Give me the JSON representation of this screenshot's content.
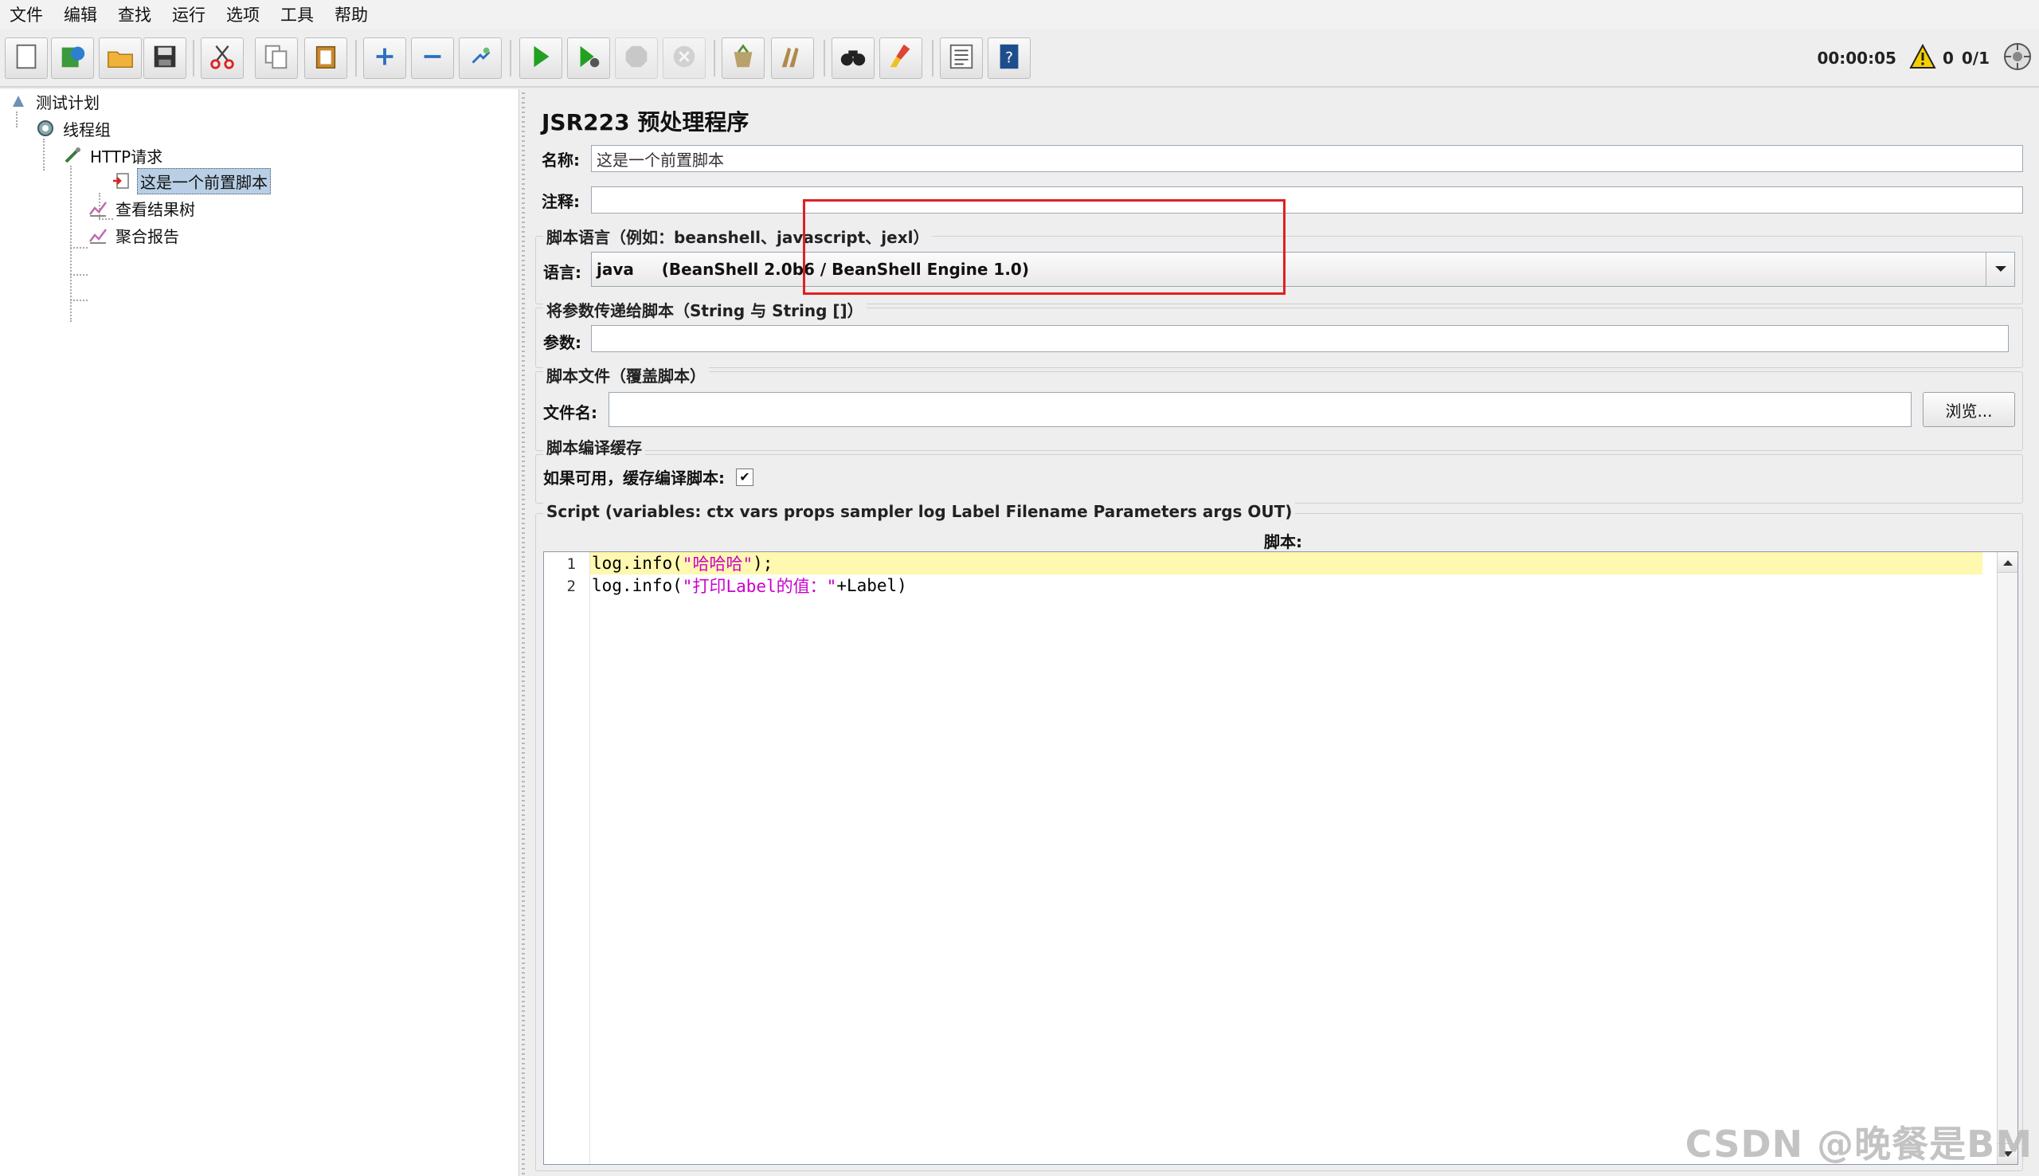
{
  "menu": [
    "文件",
    "编辑",
    "查找",
    "运行",
    "选项",
    "工具",
    "帮助"
  ],
  "toolbar": {
    "buttons": [
      {
        "name": "new-icon"
      },
      {
        "name": "templates-icon"
      },
      {
        "name": "open-icon"
      },
      {
        "name": "save-icon"
      },
      {
        "name": "cut-icon"
      },
      {
        "name": "copy-icon"
      },
      {
        "name": "paste-icon"
      },
      {
        "name": "expand-icon"
      },
      {
        "name": "collapse-icon"
      },
      {
        "name": "toggle-icon"
      },
      {
        "name": "start-icon"
      },
      {
        "name": "start-no-pause-icon"
      },
      {
        "name": "stop-icon"
      },
      {
        "name": "shutdown-icon"
      },
      {
        "name": "clear-icon"
      },
      {
        "name": "clear-all-icon"
      },
      {
        "name": "search-icon"
      },
      {
        "name": "reset-search-icon"
      },
      {
        "name": "function-helper-icon"
      },
      {
        "name": "help-icon"
      }
    ],
    "elapsed": "00:00:05",
    "warnings": "0",
    "threads": "0/1"
  },
  "tree": {
    "items": [
      {
        "label": "测试计划",
        "icon": "test-plan-icon"
      },
      {
        "label": "线程组",
        "icon": "thread-group-icon"
      },
      {
        "label": "HTTP请求",
        "icon": "http-sampler-icon"
      },
      {
        "label": "这是一个前置脚本",
        "icon": "preprocessor-icon"
      },
      {
        "label": "查看结果树",
        "icon": "listener-icon"
      },
      {
        "label": "聚合报告",
        "icon": "listener-icon"
      }
    ]
  },
  "panel": {
    "title": "JSR223 预处理程序",
    "name_label": "名称:",
    "name_value": "这是一个前置脚本",
    "comment_label": "注释:",
    "comment_value": "",
    "lang_section": "脚本语言（例如：beanshell、javascript、jexl）",
    "lang_label": "语言:",
    "lang_value": "java     (BeanShell 2.0b6 / BeanShell Engine 1.0)",
    "params_section": "将参数传递给脚本（String 与 String []）",
    "params_label": "参数:",
    "params_value": "",
    "file_section": "脚本文件（覆盖脚本）",
    "file_label": "文件名:",
    "file_value": "",
    "browse_label": "浏览...",
    "cache_section": "脚本编译缓存",
    "cache_label": "如果可用，缓存编译脚本:",
    "cache_checked": true,
    "script_section": "Script (variables: ctx vars props sampler log Label Filename Parameters args OUT)",
    "script_label": "脚本:"
  },
  "editor": {
    "lines": [
      {
        "num": "1",
        "fn": "log.info(",
        "str": "\"哈哈哈\"",
        "rest": ");"
      },
      {
        "num": "2",
        "fn": "log.info(",
        "str": "\"打印Label的值：\"",
        "rest": "+Label)"
      }
    ]
  },
  "watermark": "CSDN @晚餐是BM"
}
